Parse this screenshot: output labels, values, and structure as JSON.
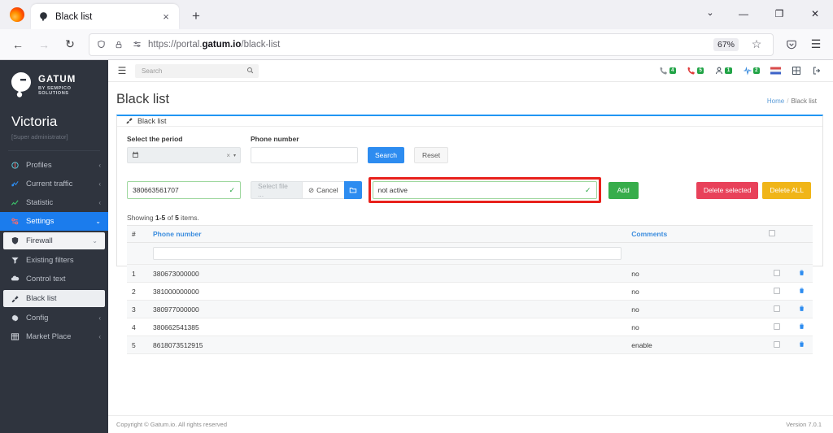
{
  "browser": {
    "tab": {
      "title": "Black list",
      "favicon_icon": "gatum-logo-icon",
      "close_icon": "×"
    },
    "newtab_icon": "+",
    "tab_list_icon": "⌄",
    "window": {
      "minimize": "—",
      "maximize": "❐",
      "close": "✕"
    },
    "nav": {
      "back_icon": "←",
      "forward_icon": "→",
      "reload_icon": "↻"
    },
    "url": {
      "prefix": "https://portal.",
      "domain": "gatum.io",
      "path": "/black-list"
    },
    "urlbar_icons": {
      "shield": "shield-icon",
      "lock": "lock-icon",
      "permissions": "permissions-icon"
    },
    "zoom_level": "67%",
    "star_icon": "☆",
    "pocket_icon": "pocket-icon",
    "menu_icon": "☰"
  },
  "sidebar": {
    "brand": {
      "name": "GATUM",
      "subtitle": "BY SEMPICO SOLUTIONS"
    },
    "user": {
      "name": "Victoria",
      "role": "[Super administrator]"
    },
    "items": [
      {
        "label": "Profiles",
        "icon": "profiles-icon",
        "chevron": "‹",
        "state": "normal"
      },
      {
        "label": "Current traffic",
        "icon": "traffic-icon",
        "chevron": "‹",
        "state": "normal"
      },
      {
        "label": "Statistic",
        "icon": "statistic-icon",
        "chevron": "‹",
        "state": "normal"
      },
      {
        "label": "Settings",
        "icon": "settings-icon",
        "chevron": "⌄",
        "state": "active-blue"
      },
      {
        "label": "Firewall",
        "icon": "firewall-shield-icon",
        "chevron": "⌄",
        "state": "white-pill"
      },
      {
        "label": "Existing filters",
        "icon": "filter-icon",
        "chevron": "",
        "state": "normal"
      },
      {
        "label": "Control text",
        "icon": "control-text-icon",
        "chevron": "",
        "state": "normal"
      },
      {
        "label": "Black list",
        "icon": "black-list-icon",
        "chevron": "",
        "state": "active-light"
      },
      {
        "label": "Config",
        "icon": "gear-icon",
        "chevron": "‹",
        "state": "normal"
      },
      {
        "label": "Market Place",
        "icon": "grid-icon",
        "chevron": "‹",
        "state": "normal"
      }
    ]
  },
  "topbar": {
    "hamburger_icon": "☰",
    "search": {
      "placeholder": "Search",
      "value": "",
      "icon": "search-icon"
    },
    "status_icons": [
      {
        "name": "phone-grey-icon",
        "badge": "4",
        "glyph": "📞"
      },
      {
        "name": "phone-red-icon",
        "badge": "5",
        "glyph": "📞"
      },
      {
        "name": "user-icon",
        "badge": "1",
        "glyph": "👤"
      },
      {
        "name": "pulse-icon",
        "badge": "2",
        "glyph": "✇"
      },
      {
        "name": "flag-icon",
        "badge": "",
        "glyph": "⚑"
      },
      {
        "name": "grid-icon",
        "badge": "",
        "glyph": "⊞"
      },
      {
        "name": "logout-icon",
        "badge": "",
        "glyph": "⇥"
      }
    ]
  },
  "page": {
    "title": "Black list",
    "breadcrumb": {
      "home": "Home",
      "separator": "/",
      "current": "Black list"
    },
    "panel_header": {
      "label": "Black list",
      "icon": "black-list-icon"
    }
  },
  "filters": {
    "period": {
      "label": "Select the period",
      "value": "",
      "calendar_icon": "📅",
      "clear_icon": "×",
      "dropdown_icon": "▾"
    },
    "phone": {
      "label": "Phone number",
      "value": "",
      "placeholder": ""
    },
    "search_button": "Search",
    "reset_button": "Reset"
  },
  "add_row": {
    "phone_input": {
      "value": "380663561707",
      "valid_icon": "✓"
    },
    "file": {
      "select_label": "Select file ...",
      "cancel_label": "Cancel",
      "cancel_icon": "⊘",
      "open_icon": "🗀"
    },
    "comment_input": {
      "value": "not active",
      "valid_icon": "✓",
      "highlighted": true,
      "highlight_color": "#e8211c"
    },
    "add_button": "Add",
    "delete_selected_button": "Delete selected",
    "delete_all_button": "Delete ALL"
  },
  "table": {
    "showing_prefix": "Showing ",
    "showing_range": "1-5",
    "showing_mid": " of ",
    "showing_total": "5",
    "showing_suffix": " items.",
    "columns": {
      "index": "#",
      "phone": "Phone number",
      "comments": "Comments",
      "select": "",
      "actions": ""
    },
    "rows": [
      {
        "index": "1",
        "phone": "380673000000",
        "comment": "no"
      },
      {
        "index": "2",
        "phone": "381000000000",
        "comment": "no"
      },
      {
        "index": "3",
        "phone": "380977000000",
        "comment": "no"
      },
      {
        "index": "4",
        "phone": "380662541385",
        "comment": "no"
      },
      {
        "index": "5",
        "phone": "8618073512915",
        "comment": "enable"
      }
    ],
    "delete_icon": "🗑"
  },
  "footer": {
    "copyright": "Copyright © Gatum.io. All rights reserved",
    "version": "Version 7.0.1"
  }
}
